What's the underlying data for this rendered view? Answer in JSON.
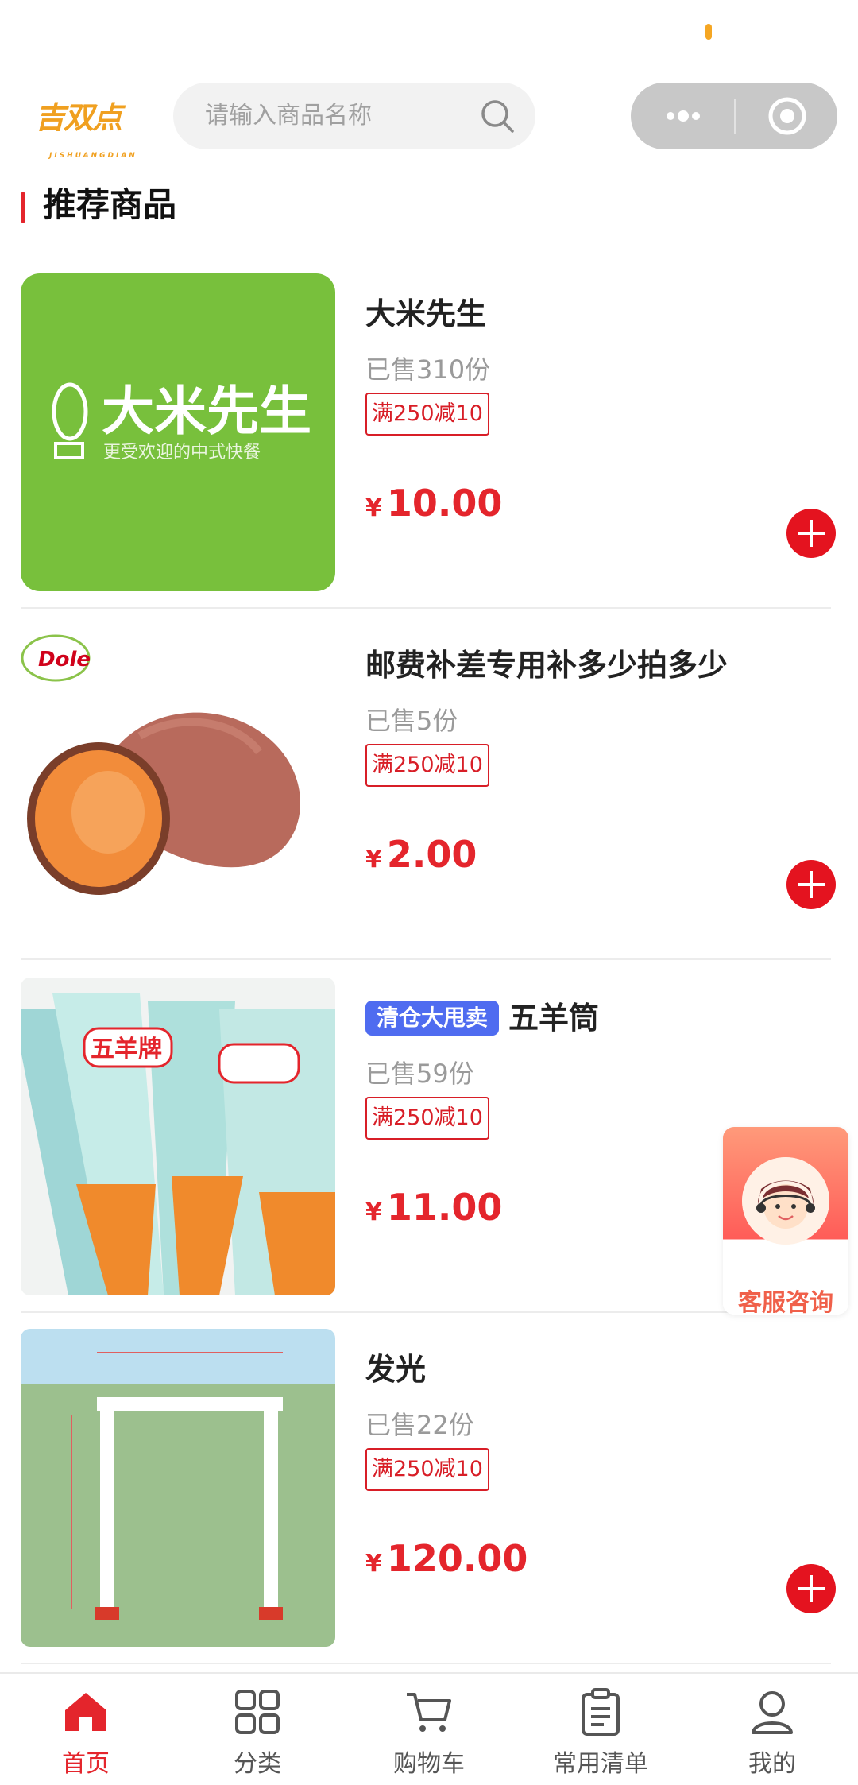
{
  "header": {
    "logo_text": "吉双点",
    "logo_sub": "JISHUANGDIAN",
    "search_placeholder": "请输入商品名称"
  },
  "section": {
    "title": "推荐商品"
  },
  "products": [
    {
      "name": "大米先生",
      "badge": "",
      "sold": "已售310份",
      "promo": "满250减10",
      "currency": "¥",
      "price": "10.00",
      "image": "green-brand-logo"
    },
    {
      "name": "邮费补差专用补多少拍多少",
      "badge": "",
      "sold": "已售5份",
      "promo": "满250减10",
      "currency": "¥",
      "price": "2.00",
      "image": "sweet-potato"
    },
    {
      "name": "五羊筒",
      "badge": "清仓大甩卖",
      "sold": "已售59份",
      "promo": "满250减10",
      "currency": "¥",
      "price": "11.00",
      "image": "ice-cream-cones"
    },
    {
      "name": "发光",
      "badge": "",
      "sold": "已售22份",
      "promo": "满250减10",
      "currency": "¥",
      "price": "120.00",
      "image": "arch-frame"
    }
  ],
  "product_image_text": {
    "brand_name": "大米先生",
    "brand_slogan": "更受欢迎的中式快餐",
    "dole": "Dole",
    "ice_cream_brand": "五羊牌"
  },
  "customer_service": {
    "label": "客服咨询"
  },
  "tabbar": [
    {
      "label": "首页",
      "icon": "home-icon",
      "active": true
    },
    {
      "label": "分类",
      "icon": "grid-icon",
      "active": false
    },
    {
      "label": "购物车",
      "icon": "cart-icon",
      "active": false
    },
    {
      "label": "常用清单",
      "icon": "clipboard-icon",
      "active": false
    },
    {
      "label": "我的",
      "icon": "user-icon",
      "active": false
    }
  ],
  "colors": {
    "accent": "#e4252c",
    "badge": "#4f6cf0",
    "logo": "#f0a020"
  }
}
